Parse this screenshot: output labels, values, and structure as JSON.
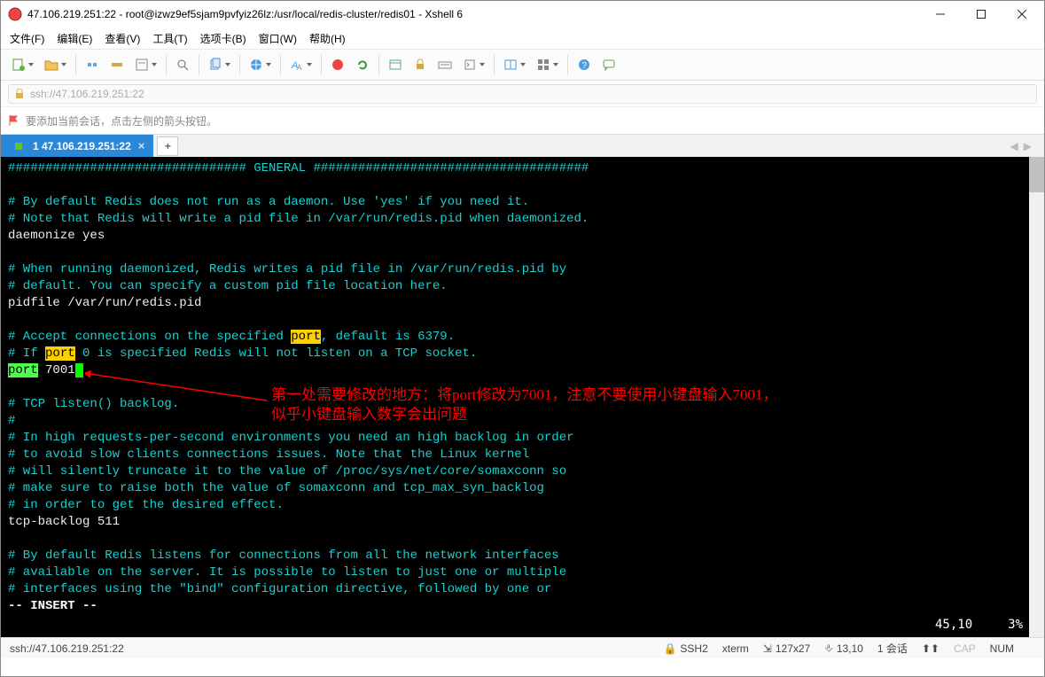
{
  "window": {
    "title": "47.106.219.251:22 - root@izwz9ef5sjam9pvfyiz26lz:/usr/local/redis-cluster/redis01 - Xshell 6"
  },
  "menu": {
    "file": "文件(F)",
    "edit": "编辑(E)",
    "view": "查看(V)",
    "tools": "工具(T)",
    "tabs": "选项卡(B)",
    "window": "窗口(W)",
    "help": "帮助(H)"
  },
  "addressbar": {
    "text": "ssh://47.106.219.251:22"
  },
  "infobar": {
    "text": "要添加当前会话，点击左侧的箭头按钮。"
  },
  "tab": {
    "label": "1 47.106.219.251:22",
    "add": "+"
  },
  "terminal": {
    "l1a": "################################ GENERAL  #####################################",
    "l2": "# By default Redis does not run as a daemon. Use 'yes' if you need it.",
    "l3": "# Note that Redis will write a pid file in /var/run/redis.pid when daemonized.",
    "l4": "daemonize yes",
    "l5": "# When running daemonized, Redis writes a pid file in /var/run/redis.pid by",
    "l6": "# default. You can specify a custom pid file location here.",
    "l7": "pidfile /var/run/redis.pid",
    "l8a": "# Accept connections on the specified ",
    "l8b": "port",
    "l8c": ", default is 6379.",
    "l9a": "# If ",
    "l9b": "port",
    "l9c": " 0 is specified Redis will not listen on a TCP socket.",
    "l10a": "port",
    "l10b": " 7001",
    "l11": "# TCP listen() backlog.",
    "l12": "#",
    "l13": "# In high requests-per-second environments you need an high backlog in order",
    "l14": "# to avoid slow clients connections issues. Note that the Linux kernel",
    "l15": "# will silently truncate it to the value of /proc/sys/net/core/somaxconn so",
    "l16": "# make sure to raise both the value of somaxconn and tcp_max_syn_backlog",
    "l17": "# in order to get the desired effect.",
    "l18": "tcp-backlog 511",
    "l19": "# By default Redis listens for connections from all the network interfaces",
    "l20": "# available on the server. It is possible to listen to just one or multiple",
    "l21": "# interfaces using the \"bind\" configuration directive, followed by one or",
    "insert": "-- INSERT --",
    "pos": "45,10",
    "pct": "3%"
  },
  "annotation": {
    "line1": "第一处需要修改的地方：将port修改为7001，注意不要使用小键盘输入7001，",
    "line2": "似乎小键盘输入数字会出问题"
  },
  "statusbar": {
    "left": "ssh://47.106.219.251:22",
    "ssh": "SSH2",
    "term": "xterm",
    "size": "127x27",
    "cursor": "13,10",
    "sessions": "1 会话",
    "cap": "CAP",
    "num": "NUM"
  }
}
